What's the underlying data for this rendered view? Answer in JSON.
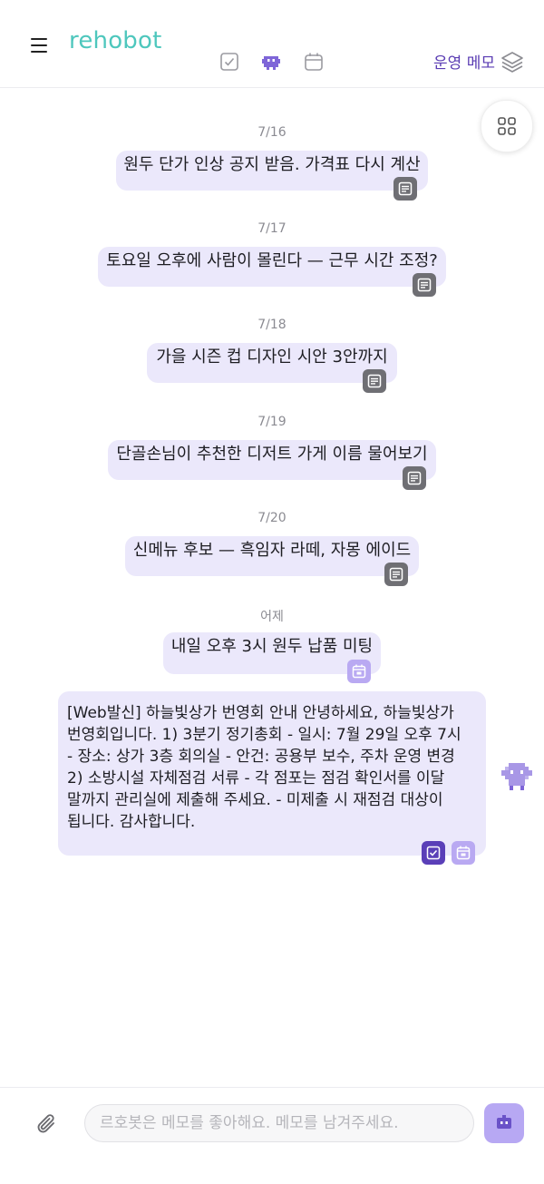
{
  "header": {
    "logo": "rehobot",
    "ops_memo_label": "운영 메모"
  },
  "messages": [
    {
      "date": "7/16",
      "text": "원두 단가 인상 공지 받음. 가격표 다시 계산",
      "badge": "memo-icon"
    },
    {
      "date": "7/17",
      "text": "토요일 오후에 사람이 몰린다 — 근무 시간 조정?",
      "badge": "memo-icon"
    },
    {
      "date": "7/18",
      "text": "가을 시즌 컵 디자인 시안 3안까지",
      "badge": "memo-icon"
    },
    {
      "date": "7/19",
      "text": "단골손님이 추천한 디저트 가게 이름 물어보기",
      "badge": "memo-icon"
    },
    {
      "date": "7/20",
      "text": "신메뉴 후보 — 흑임자 라떼, 자몽 에이드",
      "badge": "memo-icon"
    },
    {
      "date": "어제",
      "text": "내일 오후 3시 원두 납품 미팅",
      "badge": "calendar-icon"
    }
  ],
  "long_message": {
    "lines": [
      "[Web발신] 하늘빛상가 번영회 안내 안녕하세요, 하늘빛상가",
      "번영회입니다. 1) 3분기 정기총회 - 일시: 7월 29일 오후 7시",
      "- 장소: 상가 3층 회의실 - 안건: 공용부 보수, 주차 운영 변경",
      "2) 소방시설 자체점검 서류 - 각 점포는 점검 확인서를 이달",
      "말까지 관리실에 제출해 주세요. - 미제출 시 재점검 대상이",
      "됩니다. 감사합니다."
    ],
    "badges": [
      "checkbox-icon",
      "calendar-icon"
    ]
  },
  "input": {
    "placeholder": "르호봇은 메모를 좋아해요. 메모를 남겨주세요."
  },
  "colors": {
    "accent": "#5a3cb3",
    "logo": "#4ec7bd",
    "bubble": "#ebe8fb",
    "send_button": "#b7a8f3"
  }
}
